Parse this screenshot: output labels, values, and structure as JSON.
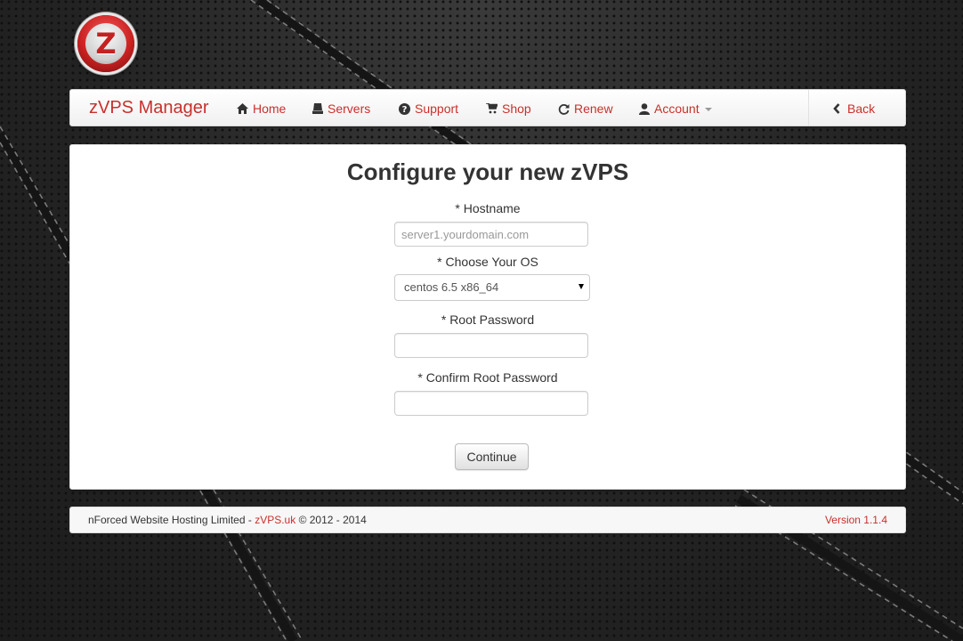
{
  "logo": {
    "letter": "Z"
  },
  "navbar": {
    "brand": "zVPS Manager",
    "items": [
      {
        "label": "Home",
        "icon": "home-icon"
      },
      {
        "label": "Servers",
        "icon": "server-icon"
      },
      {
        "label": "Support",
        "icon": "question-circle-icon"
      },
      {
        "label": "Shop",
        "icon": "cart-icon"
      },
      {
        "label": "Renew",
        "icon": "refresh-icon"
      },
      {
        "label": "Account",
        "icon": "user-icon"
      }
    ],
    "back": {
      "label": "Back",
      "icon": "chevron-left-icon"
    }
  },
  "form": {
    "title": "Configure your new zVPS",
    "hostname_label": "* Hostname",
    "hostname_placeholder": "server1.yourdomain.com",
    "hostname_value": "",
    "os_label": "* Choose Your OS",
    "os_selected": "centos 6.5 x86_64",
    "root_password_label": "* Root Password",
    "confirm_password_label": "* Confirm Root Password",
    "continue_label": "Continue"
  },
  "footer": {
    "company": "nForced Website Hosting Limited - ",
    "site_link": "zVPS.uk",
    "copyright": " © 2012 - 2014",
    "version": "Version 1.1.4"
  },
  "colors": {
    "accent": "#c9302c",
    "background": "#262626"
  }
}
